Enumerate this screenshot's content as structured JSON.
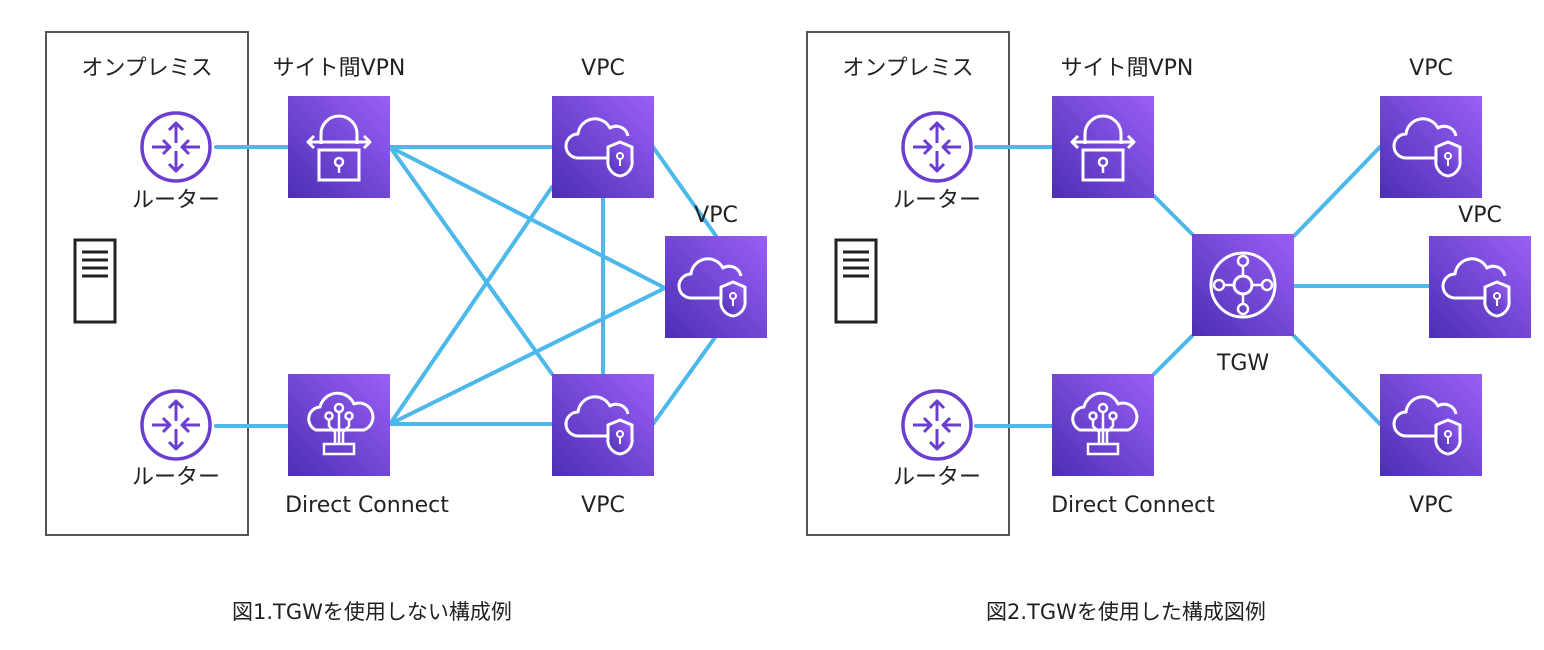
{
  "fig1": {
    "onprem_label": "オンプレミス",
    "vpn_label": "サイト間VPN",
    "dx_label": "Direct Connect",
    "router_labels": [
      "ルーター",
      "ルーター"
    ],
    "vpc_labels": [
      "VPC",
      "VPC",
      "VPC"
    ],
    "caption": "図1.TGWを使用しない構成例"
  },
  "fig2": {
    "onprem_label": "オンプレミス",
    "vpn_label": "サイト間VPN",
    "dx_label": "Direct Connect",
    "router_labels": [
      "ルーター",
      "ルーター"
    ],
    "vpc_labels": [
      "VPC",
      "VPC",
      "VPC"
    ],
    "tgw_label": "TGW",
    "caption": "図2.TGWを使用した構成図例"
  },
  "colors": {
    "line": "#4db8ea",
    "icon_top": "#9b5ff7",
    "icon_bottom": "#4b2fb3",
    "router": "#6a3fd0",
    "box_border": "#555555"
  }
}
